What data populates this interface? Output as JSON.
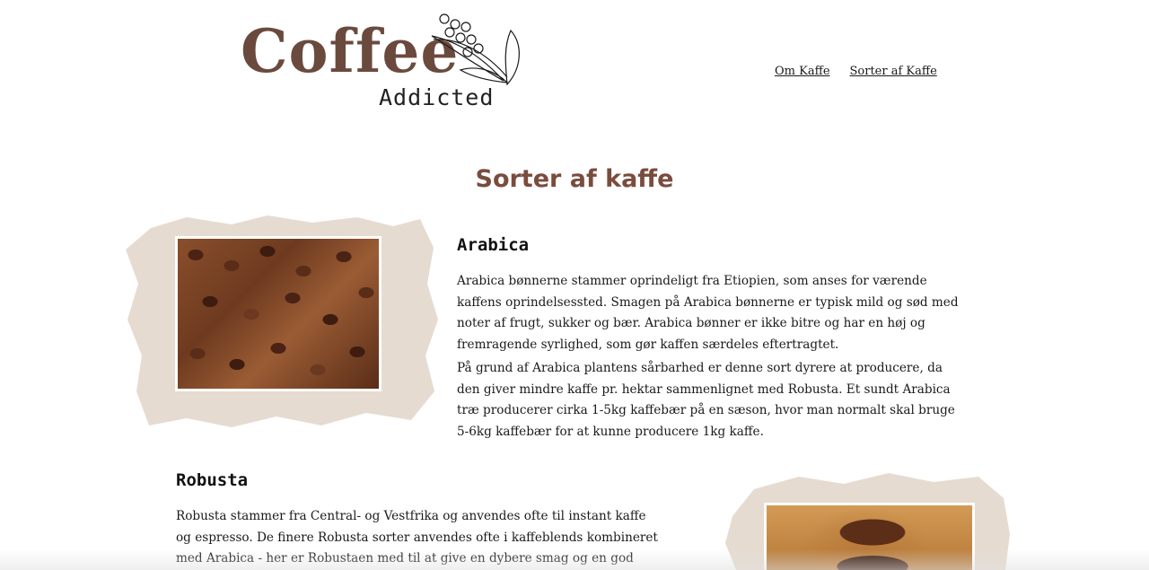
{
  "logo": {
    "word": "Coffee",
    "sub": "Addicted"
  },
  "nav": {
    "items": [
      {
        "label": "Om Kaffe"
      },
      {
        "label": "Sorter af Kaffe"
      }
    ]
  },
  "page": {
    "title": "Sorter af kaffe"
  },
  "sections": {
    "arabica": {
      "heading": "Arabica",
      "paragraphs": [
        "Arabica bønnerne stammer oprindeligt fra Etiopien, som anses for værende kaffens oprindelsessted. Smagen på Arabica bønnerne er typisk mild og sød med noter af frugt, sukker og bær. Arabica bønner er ikke bitre og har en høj og fremragende syrlighed, som gør kaffen særdeles eftertragtet.",
        "På grund af Arabica plantens sårbarhed er denne sort dyrere at producere, da den giver mindre kaffe pr. hektar sammenlignet med Robusta. Et sundt Arabica træ producerer cirka 1-5kg kaffebær på en sæson, hvor man normalt skal bruge 5-6kg kaffebær for at kunne producere 1kg kaffe."
      ]
    },
    "robusta": {
      "heading": "Robusta",
      "paragraphs": [
        "Robusta stammer fra Central- og Vestfrika og anvendes ofte til instant kaffe og espresso. De finere Robusta sorter anvendes ofte i kaffeblends kombineret med Arabica - her er Robustaen med til at give en dybere smag og en god crema."
      ]
    }
  },
  "colors": {
    "accent": "#7a4c3d",
    "brush": "#e6dbd0",
    "logo": "#6b4a3e"
  }
}
